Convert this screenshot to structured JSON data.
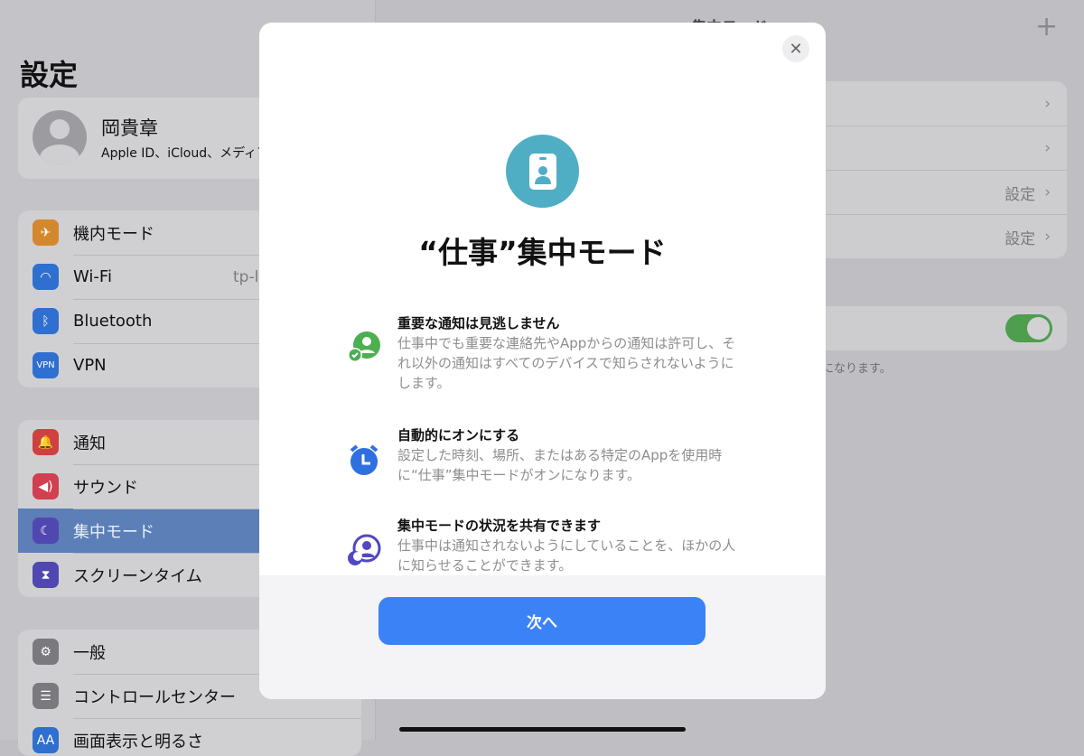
{
  "sidebar": {
    "title": "設定",
    "profile": {
      "name": "岡貴章",
      "subtitle": "Apple ID、iCloud、メディア"
    },
    "group1": [
      {
        "label": "機内モード",
        "icon": "airplane-icon",
        "color": "#d4882e"
      },
      {
        "label": "Wi-Fi",
        "value": "tp-l",
        "icon": "wifi-icon",
        "color": "#2f6fd0"
      },
      {
        "label": "Bluetooth",
        "icon": "bluetooth-icon",
        "color": "#2f6fd0"
      },
      {
        "label": "VPN",
        "icon": "vpn-icon",
        "color": "#2f6fd0"
      }
    ],
    "group2": [
      {
        "label": "通知",
        "icon": "bell-icon",
        "color": "#d04040"
      },
      {
        "label": "サウンド",
        "icon": "speaker-icon",
        "color": "#d04050"
      },
      {
        "label": "集中モード",
        "icon": "moon-icon",
        "color": "#5048b0",
        "selected": true
      },
      {
        "label": "スクリーンタイム",
        "icon": "hourglass-icon",
        "color": "#5048b0"
      }
    ],
    "group3": [
      {
        "label": "一般",
        "icon": "gear-icon",
        "color": "#7a7a7e"
      },
      {
        "label": "コントロールセンター",
        "icon": "switches-icon",
        "color": "#7a7a7e"
      },
      {
        "label": "画面表示と明るさ",
        "icon": "brightness-icon",
        "color": "#2f6fd0"
      }
    ]
  },
  "main": {
    "title": "集中モード",
    "rows": [
      {
        "value": ""
      },
      {
        "value": ""
      },
      {
        "value": "設定"
      },
      {
        "value": "設定"
      }
    ],
    "footnote": "になります。",
    "toggle_on": true
  },
  "modal": {
    "title": "“仕事”集中モード",
    "close": "✕",
    "next_label": "次へ",
    "features": [
      {
        "heading": "重要な通知は見逃しません",
        "desc": "仕事中でも重要な連絡先やAppからの通知は許可し、それ以外の通知はすべてのデバイスで知らされないようにします。",
        "icon": "person-check-icon",
        "color": "#4caf50"
      },
      {
        "heading": "自動的にオンにする",
        "desc": "設定した時刻、場所、またはある特定のAppを使用時に“仕事”集中モードがオンになります。",
        "icon": "alarm-clock-icon",
        "color": "#2f6fe0"
      },
      {
        "heading": "集中モードの状況を共有できます",
        "desc": "仕事中は通知されないようにしていることを、ほかの人に知らせることができます。",
        "icon": "person-moon-icon",
        "color": "#5048c0"
      }
    ]
  }
}
